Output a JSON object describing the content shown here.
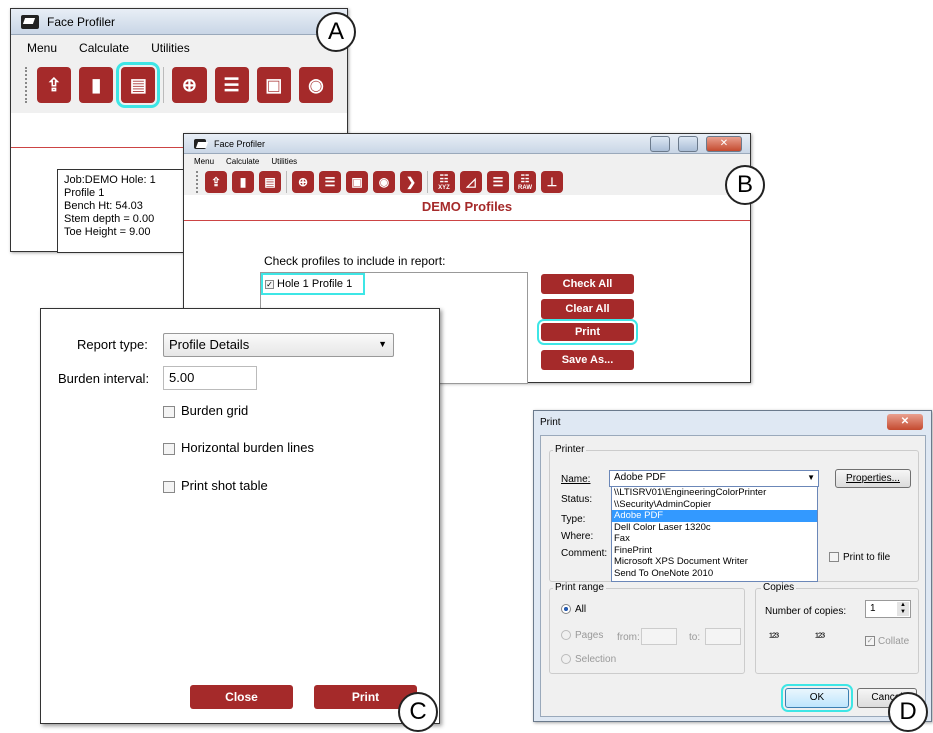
{
  "callouts": {
    "a": "A",
    "b": "B",
    "c": "C",
    "d": "D"
  },
  "winA": {
    "title": "Face Profiler",
    "menu": [
      "Menu",
      "Calculate",
      "Utilities"
    ],
    "info_lines": [
      "Job:DEMO Hole: 1",
      "Profile 1",
      "Bench Ht: 54.03",
      "Stem depth = 0.00",
      "Toe Height = 9.00"
    ]
  },
  "winB": {
    "title": "Face Profiler",
    "menu": [
      "Menu",
      "Calculate",
      "Utilities"
    ],
    "heading": "DEMO Profiles",
    "check_prompt": "Check profiles to include in report:",
    "profile_item": "Hole 1 Profile 1",
    "buttons": {
      "check_all": "Check All",
      "clear_all": "Clear All",
      "print": "Print",
      "save_as": "Save As..."
    },
    "icon_labels": {
      "xyz": "XYZ",
      "raw": "RAW"
    }
  },
  "winC": {
    "report_type_label": "Report type:",
    "report_type_value": "Profile Details",
    "burden_interval_label": "Burden interval:",
    "burden_interval_value": "5.00",
    "options": [
      "Burden grid",
      "Horizontal burden lines",
      "Print shot table"
    ],
    "close_label": "Close",
    "print_label": "Print"
  },
  "winD": {
    "title": "Print",
    "printer_group": "Printer",
    "name_label": "Name:",
    "name_value": "Adobe PDF",
    "properties_label": "Properties...",
    "status_label": "Status:",
    "type_label": "Type:",
    "where_label": "Where:",
    "comment_label": "Comment:",
    "dropdown_options": [
      "\\\\LTISRV01\\EngineeringColorPrinter",
      "\\\\Security\\AdminCopier",
      "Adobe PDF",
      "Dell Color Laser 1320c",
      "Fax",
      "FinePrint",
      "Microsoft XPS Document Writer",
      "Send To OneNote 2010"
    ],
    "selected_option_index": 2,
    "print_to_file_label": "Print to file",
    "print_range_label": "Print range",
    "all_label": "All",
    "pages_label": "Pages",
    "from_label": "from:",
    "to_label": "to:",
    "selection_label": "Selection",
    "copies_label": "Copies",
    "number_of_copies_label": "Number of copies:",
    "number_of_copies_value": "1",
    "collate_label": "Collate",
    "ok_label": "OK",
    "cancel_label": "Cancel"
  },
  "colors": {
    "accent": "#a52a2a",
    "highlight": "#3ee6e6"
  },
  "icons": [
    "upload-icon",
    "trash-icon",
    "clipboard-icon",
    "crosshair-icon",
    "list-icon",
    "frame-icon",
    "eye-icon",
    "arrow-icon",
    "xyz-grid-icon",
    "triangle-icon",
    "rows-icon",
    "raw-grid-icon",
    "axis-icon"
  ]
}
